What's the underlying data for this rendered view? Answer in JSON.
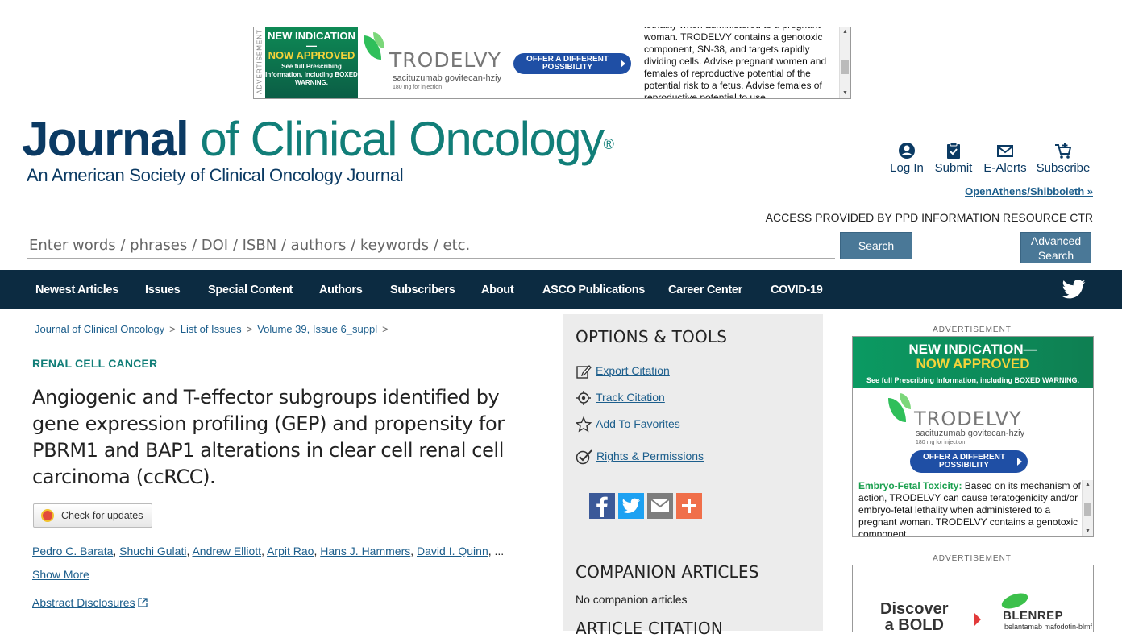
{
  "top_ad": {
    "side_label": "ADVERTISEMENT",
    "badge_line1": "NEW INDICATION—",
    "badge_line2": "NOW APPROVED",
    "badge_line3": "See full Prescribing Information, including BOXED WARNING.",
    "brand": "TRODELVY",
    "generic": "sacituzumab govitecan-hziy",
    "dose": "180 mg for injection",
    "cta": "OFFER A DIFFERENT POSSIBILITY",
    "isi_text": "lethality when administered to a pregnant woman. TRODELVY contains a genotoxic component, SN-38, and targets rapidly dividing cells. Advise pregnant women and females of reproductive potential of the potential risk to a fetus. Advise females of reproductive potential to use"
  },
  "header": {
    "journal_bold": "Journal",
    "journal_rest": " of Clinical Oncology",
    "registered": "®",
    "subtitle": "An American Society of Clinical Oncology Journal",
    "login": "Log In",
    "submit": "Submit",
    "ealerts": "E-Alerts",
    "subscribe": "Subscribe",
    "openathens": "OpenAthens/Shibboleth »",
    "access": "ACCESS PROVIDED BY PPD INFORMATION RESOURCE CTR"
  },
  "search": {
    "placeholder": "Enter words / phrases / DOI / ISBN / authors / keywords / etc.",
    "button": "Search",
    "advanced_line1": "Advanced",
    "advanced_line2": "Search"
  },
  "nav": {
    "items": [
      "Newest Articles",
      "Issues",
      "Special Content",
      "Authors",
      "Subscribers",
      "About",
      "ASCO Publications",
      "Career Center",
      "COVID-19"
    ]
  },
  "breadcrumb": {
    "items": [
      "Journal of Clinical Oncology",
      "List of Issues",
      "Volume 39, Issue 6_suppl"
    ],
    "separator": ">"
  },
  "article": {
    "category": "RENAL CELL CANCER",
    "title": "Angiogenic and T-effector subgroups identified by gene expression profiling (GEP) and propensity for PBRM1 and BAP1 alterations in clear cell renal cell carcinoma (ccRCC).",
    "check_updates": "Check for updates",
    "authors": [
      "Pedro C. Barata",
      "Shuchi Gulati",
      "Andrew Elliott",
      "Arpit Rao",
      "Hans J. Hammers",
      "David I. Quinn"
    ],
    "authors_more": "...",
    "show_more": "Show More",
    "abstract_disclosures": "Abstract Disclosures"
  },
  "options": {
    "heading": "OPTIONS & TOOLS",
    "export": "Export Citation",
    "track": "Track Citation",
    "favorites": "Add To Favorites",
    "rights": "Rights & Permissions",
    "companion_heading": "COMPANION ARTICLES",
    "companion_text": "No companion articles",
    "citation_heading": "ARTICLE CITATION"
  },
  "side_ad": {
    "label": "ADVERTISEMENT",
    "line1": "NEW INDICATION—",
    "line2": "NOW APPROVED",
    "line3": "See full Prescribing Information, including BOXED WARNING.",
    "brand": "TRODELVY",
    "generic": "sacituzumab govitecan-hziy",
    "dose": "180 mg for injection",
    "cta": "OFFER A DIFFERENT POSSIBILITY",
    "isi_bold": "Embryo-Fetal Toxicity:",
    "isi_text": " Based on its mechanism of action, TRODELVY can cause teratogenicity and/or embryo-fetal lethality when administered to a pregnant woman. TRODELVY contains a genotoxic component"
  },
  "bottom_ad": {
    "label": "ADVERTISEMENT",
    "headline_line1": "Discover",
    "headline_line2": "a BOLD",
    "brand": "BLENREP",
    "generic": "belantamab mafodotin-blmf"
  },
  "colors": {
    "nav_bg": "#0c2b41",
    "journal_teal": "#117e78",
    "journal_navy": "#0b3a63",
    "link": "#1c5e8c",
    "button_blue": "#4a7897",
    "panel_bg": "#ececec"
  }
}
